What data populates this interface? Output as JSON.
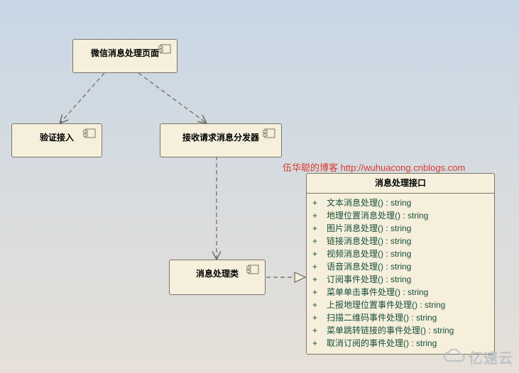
{
  "boxes": {
    "page": "微信消息处理页面",
    "verify": "验证接入",
    "dispatcher": "接收请求消息分发器",
    "handler": "消息处理类"
  },
  "interface": {
    "title": "消息处理接口",
    "ops": [
      "文本消息处理() : string",
      "地理位置消息处理() : string",
      "图片消息处理() : string",
      "链接消息处理() : string",
      "视频消息处理() : string",
      "语音消息处理() : string",
      "订阅事件处理() : string",
      "菜单单击事件处理() : string",
      "上报地理位置事件处理() : string",
      "扫描二维码事件处理() : string",
      "菜单跳转链接的事件处理() : string",
      "取消订阅的事件处理() : string"
    ]
  },
  "watermark": {
    "red": "伍华聪的博客 http://wuhuacong.cnblogs.com",
    "logo": "亿速云"
  }
}
